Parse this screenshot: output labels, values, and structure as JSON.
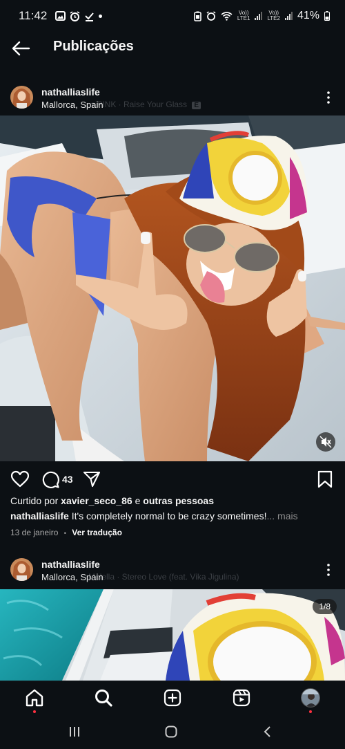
{
  "status_bar": {
    "time": "11:42",
    "battery": "41%",
    "sim1_label": "LTE1",
    "sim2_label": "LTE2",
    "volte1": "Vo))",
    "volte2": "Vo))"
  },
  "header": {
    "title": "Publicações"
  },
  "posts": [
    {
      "username": "nathalliaslife",
      "location": "Mallorca, Spain",
      "music": "♫ PINK · Raise Your Glass",
      "explicit_badge": "E"
    },
    {
      "username": "nathalliaslife",
      "location": "Mallorca, Spain",
      "music": "Molella · Stereo Love (feat. Vika Jigulina)",
      "carousel_counter": "1/8"
    }
  ],
  "actions": {
    "comment_count": "43"
  },
  "likes": {
    "prefix": "Curtido por ",
    "user": "xavier_seco_86",
    "suffix": " e ",
    "others": "outras pessoas"
  },
  "caption": {
    "username": "nathalliaslife",
    "text": " It's completely normal to be crazy sometimes!",
    "more": "... mais"
  },
  "meta": {
    "date": "13 de janeiro",
    "separator": "•",
    "translate": "Ver tradução"
  },
  "colors": {
    "background": "#0c1014",
    "text": "#f5f5f5",
    "notification_dot": "#ff3040"
  }
}
